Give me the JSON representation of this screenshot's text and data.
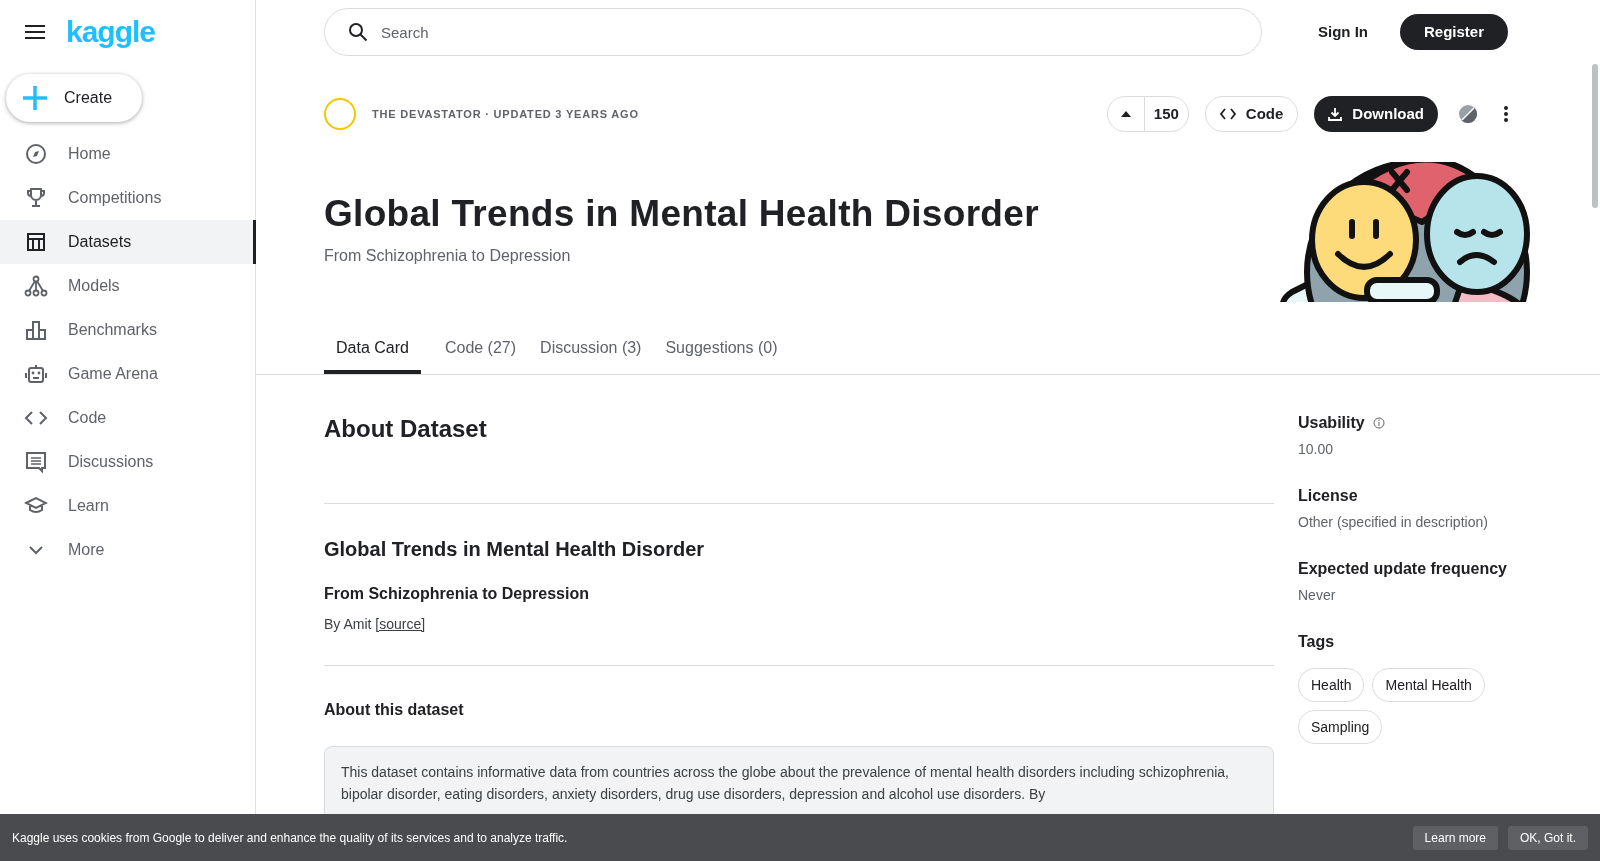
{
  "sidebar": {
    "logo": "kaggle",
    "create": "Create",
    "items": [
      {
        "label": "Home",
        "kind": "compass",
        "selected": false
      },
      {
        "label": "Competitions",
        "kind": "trophy",
        "selected": false
      },
      {
        "label": "Datasets",
        "kind": "table",
        "selected": true
      },
      {
        "label": "Models",
        "kind": "graph",
        "selected": false
      },
      {
        "label": "Benchmarks",
        "kind": "bars",
        "selected": false
      },
      {
        "label": "Game Arena",
        "kind": "robot",
        "selected": false
      },
      {
        "label": "Code",
        "kind": "code",
        "selected": false
      },
      {
        "label": "Discussions",
        "kind": "chat",
        "selected": false
      },
      {
        "label": "Learn",
        "kind": "cap",
        "selected": false
      },
      {
        "label": "More",
        "kind": "chevron",
        "selected": false
      }
    ]
  },
  "header": {
    "search": {
      "placeholder": "Search"
    },
    "sign_in": "Sign In",
    "register": "Register"
  },
  "dataset": {
    "meta": "THE DEVASTATOR · UPDATED 3 YEARS AGO",
    "votes": "150",
    "code_button": "Code",
    "download_button": "Download",
    "title": "Global Trends in Mental Health Disorder",
    "subtitle": "From Schizophrenia to Depression"
  },
  "tabs": [
    {
      "label": "Data Card",
      "selected": true
    },
    {
      "label": "Code (27)",
      "selected": false
    },
    {
      "label": "Discussion (3)",
      "selected": false
    },
    {
      "label": "Suggestions (0)",
      "selected": false
    }
  ],
  "about": {
    "heading": "About Dataset",
    "section_title": "Global Trends in Mental Health Disorder",
    "section_subtitle": "From Schizophrenia to Depression",
    "byline": "By Amit",
    "source_link": "[source]",
    "about_heading": "About this dataset",
    "description": "This dataset contains informative data from countries across the globe about the prevalence of mental health disorders including schizophrenia, bipolar disorder, eating disorders, anxiety disorders, drug use disorders, depression and alcohol use disorders. By"
  },
  "details": [
    {
      "label": "Usability",
      "value": "10.00",
      "info": true
    },
    {
      "label": "License",
      "value": "Other (specified in description)",
      "info": false
    },
    {
      "label": "Expected update frequency",
      "value": "Never",
      "info": false
    }
  ],
  "tags": {
    "heading": "Tags",
    "items": [
      "Health",
      "Mental Health",
      "Sampling"
    ]
  },
  "cookie_banner": {
    "text": "Kaggle uses cookies from Google to deliver and enhance the quality of its services and to analyze traffic.",
    "buttons": [
      "Learn more",
      "OK, Got it."
    ]
  }
}
